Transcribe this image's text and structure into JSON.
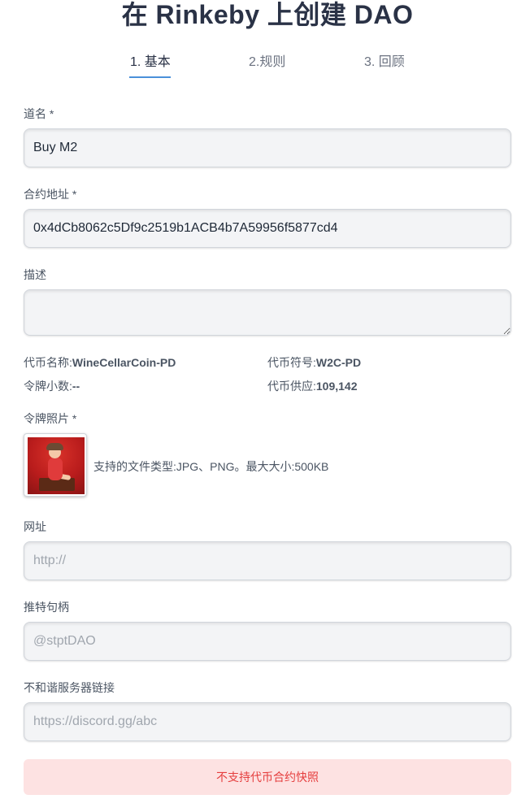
{
  "page": {
    "title": "在 Rinkeby 上创建 DAO"
  },
  "tabs": [
    {
      "label": "1. 基本"
    },
    {
      "label": "2.规则"
    },
    {
      "label": "3. 回顾"
    }
  ],
  "form": {
    "name": {
      "label": "道名 *",
      "value": "Buy M2"
    },
    "contract": {
      "label": "合约地址 *",
      "value": "0x4dCb8062c5Df9c2519b1ACB4b7A59956f5877cd4"
    },
    "description": {
      "label": "描述",
      "value": ""
    },
    "token_info": {
      "name_label": "代币名称:",
      "name_value": "WineCellarCoin-PD",
      "symbol_label": "代币符号:",
      "symbol_value": "W2C-PD",
      "decimals_label": "令牌小数:",
      "decimals_value": "--",
      "supply_label": "代币供应:",
      "supply_value": "109,142"
    },
    "photo": {
      "label": "令牌照片 *",
      "hint": "支持的文件类型:JPG、PNG。最大大小:500KB"
    },
    "website": {
      "label": "网址",
      "placeholder": "http://"
    },
    "twitter": {
      "label": "推特句柄",
      "placeholder": "@stptDAO"
    },
    "discord": {
      "label": "不和谐服务器链接",
      "placeholder": "https://discord.gg/abc"
    }
  },
  "banner": {
    "text": "不支持代币合约快照"
  },
  "colors": {
    "accent": "#4a90d9",
    "banner_bg": "#fde2e2",
    "banner_text": "#e53e3e"
  }
}
